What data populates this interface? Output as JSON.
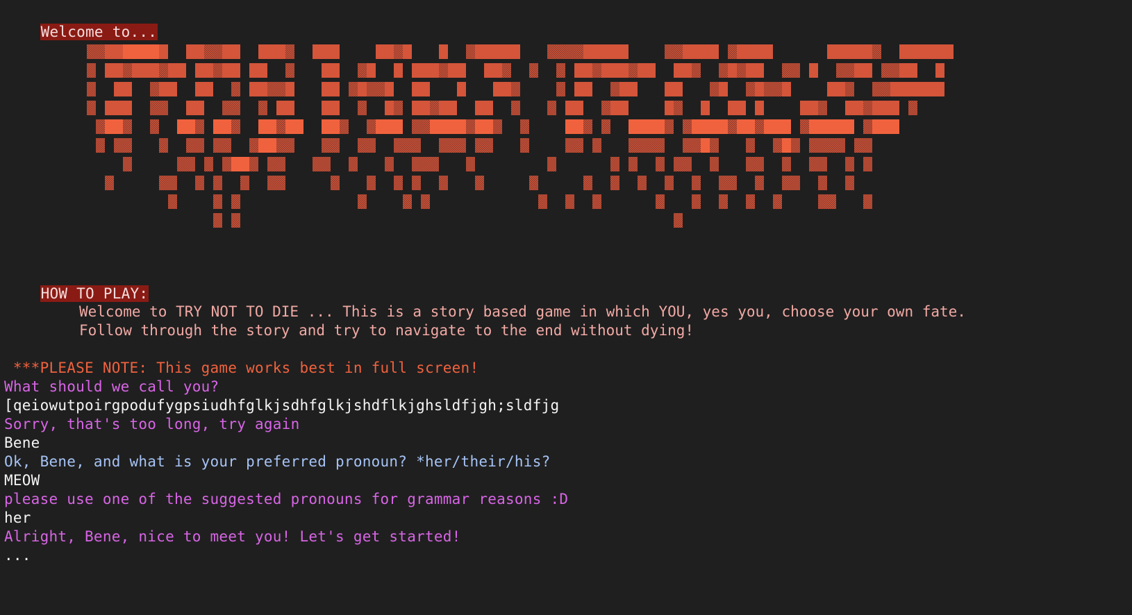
{
  "banner": {
    "welcome_label": "Welcome to...",
    "art_caption": "TRY NOT TO DIE",
    "colors": {
      "bright": "#f0623e",
      "mid": "#d4553a",
      "dim": "#8a3a2c"
    }
  },
  "howto": {
    "heading": "HOW TO PLAY:",
    "line1": "Welcome to TRY NOT TO DIE ... This is a story based game in which YOU, yes you, choose your own fate.",
    "line2": "Follow through the story and try to navigate to the end without dying!"
  },
  "note": " ***PLEASE NOTE: This game works best in full screen!",
  "transcript": [
    {
      "text": "What should we call you?",
      "style": "magenta"
    },
    {
      "text": "[qeiowutpoirgpodufygpsiudhfglkjsdhfglkjshdflkjghsldfjgh;sldfjg",
      "style": "white"
    },
    {
      "text": "Sorry, that's too long, try again",
      "style": "magenta"
    },
    {
      "text": "Bene",
      "style": "white"
    },
    {
      "text": "Ok, Bene, and what is your preferred pronoun? *her/their/his?",
      "style": "blue"
    },
    {
      "text": "MEOW",
      "style": "white"
    },
    {
      "text": "please use one of the suggested pronouns for grammar reasons :D",
      "style": "magenta"
    },
    {
      "text": "her",
      "style": "white"
    },
    {
      "text": "Alright, Bene, nice to meet you! Let's get started!",
      "style": "magenta"
    },
    {
      "text": "...",
      "style": "white"
    }
  ]
}
